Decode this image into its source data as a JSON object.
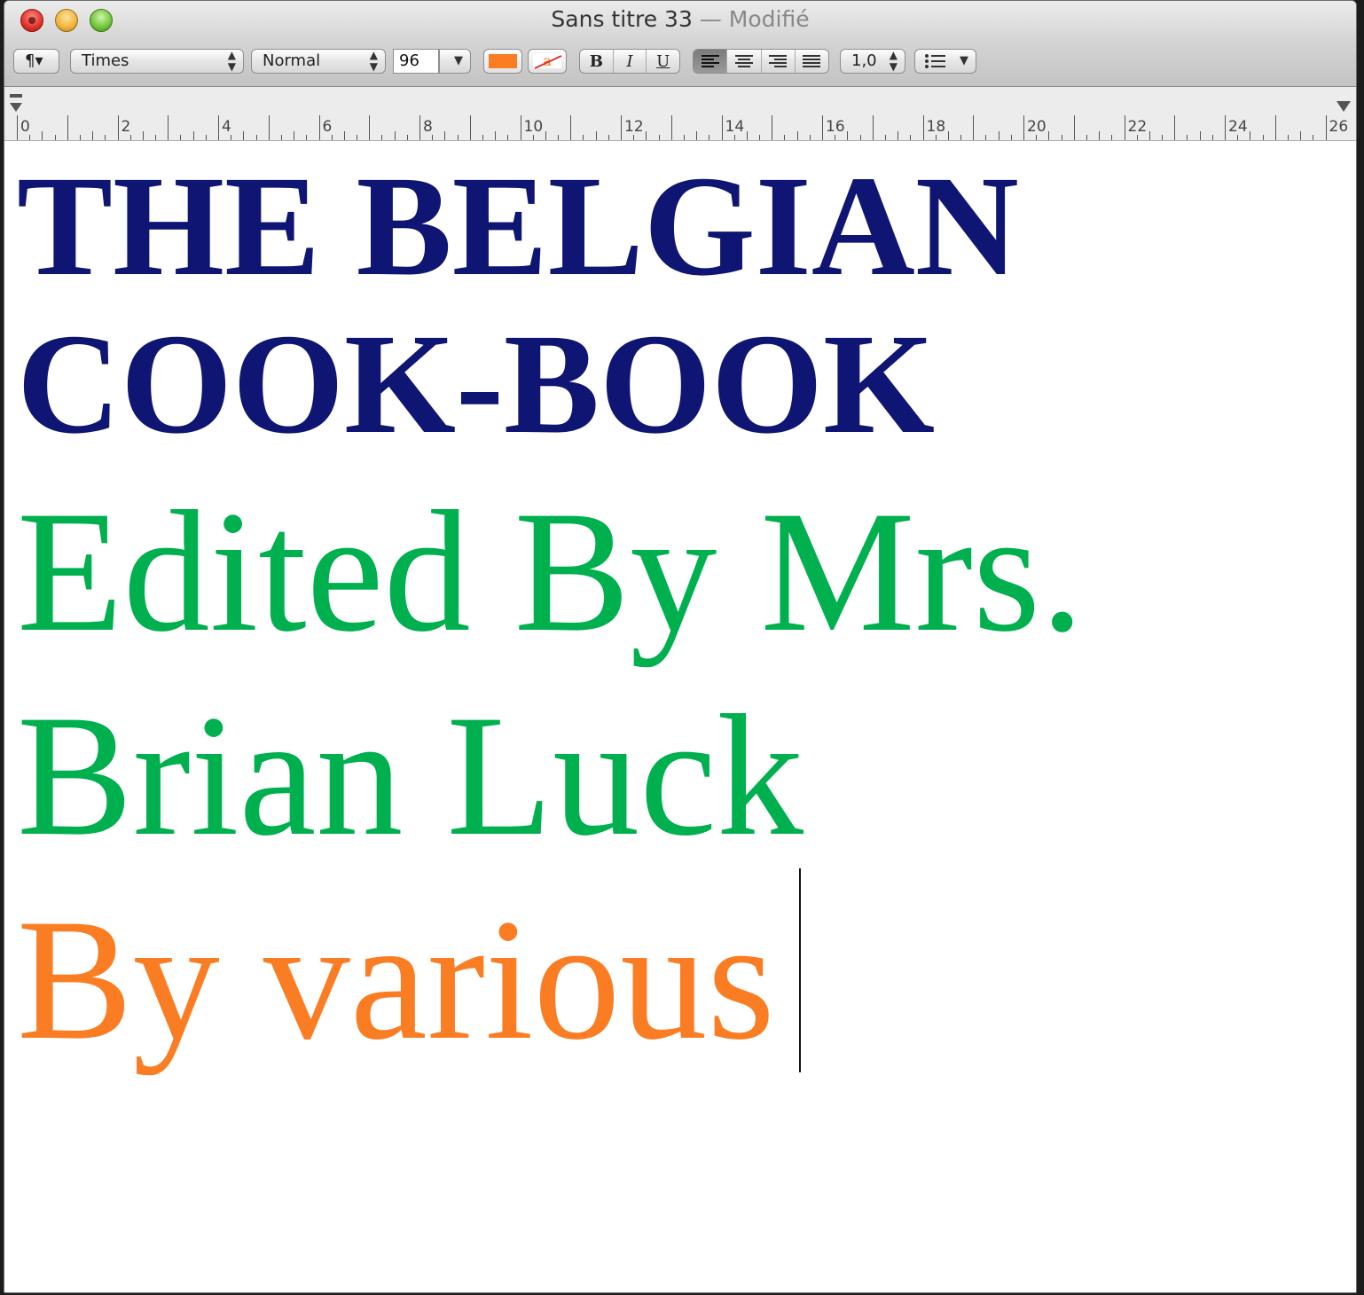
{
  "window": {
    "title": "Sans titre 33",
    "title_separator": " — ",
    "status": "Modifié"
  },
  "toolbar": {
    "paragraph_style_label": "¶▾",
    "font_family": "Times",
    "font_style": "Normal",
    "font_size": "96",
    "text_color": "#fa7d24",
    "highlight_glyph": "a",
    "bold_label": "B",
    "italic_label": "I",
    "underline_label": "U",
    "line_spacing": "1,0",
    "active_alignment": "left"
  },
  "ruler": {
    "labels": [
      "0",
      "2",
      "4",
      "6",
      "8",
      "10",
      "12",
      "14",
      "16",
      "18",
      "20",
      "22",
      "24",
      "26"
    ]
  },
  "document": {
    "lines": [
      {
        "text": "THE BELGIAN",
        "color": "#0f1573",
        "weight": "bold"
      },
      {
        "text": "COOK-BOOK",
        "color": "#0f1573",
        "weight": "bold"
      },
      {
        "text": "Edited By Mrs.",
        "color": "#00b04f",
        "weight": "normal"
      },
      {
        "text": "Brian Luck",
        "color": "#00b04f",
        "weight": "normal"
      },
      {
        "text": "By various",
        "color": "#fa7d24",
        "weight": "normal"
      }
    ]
  }
}
